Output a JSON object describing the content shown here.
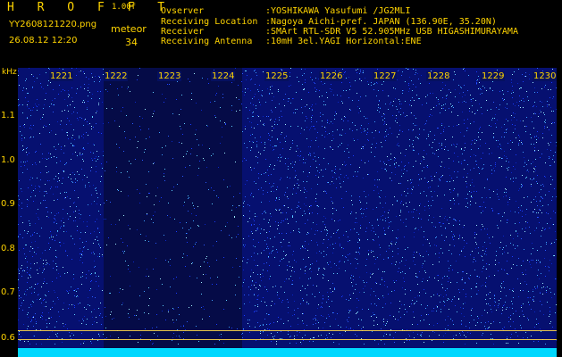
{
  "header": {
    "app_title": "H R O F F T",
    "version": "1.00f",
    "filename": "YY2608121220.png",
    "timestamp": "26.08.12 12:20",
    "detection_type": "meteor",
    "detection_count": "34",
    "info": [
      {
        "key": "Ovserver",
        "value": ":YOSHIKAWA Yasufumi /JG2MLI"
      },
      {
        "key": "Receiving Location",
        "value": ":Nagoya Aichi-pref. JAPAN (136.90E, 35.20N)"
      },
      {
        "key": "Receiver",
        "value": ":SMArt RTL-SDR V5 52.905MHz USB HIGASHIMURAYAMA"
      },
      {
        "key": "Receiving Antenna",
        "value": ":10mH 3el.YAGI Horizontal:ENE"
      }
    ]
  },
  "axes": {
    "y_unit": "kHz",
    "x_ticks": [
      "1221",
      "1222",
      "1223",
      "1224",
      "1225",
      "1226",
      "1227",
      "1228",
      "1229",
      "1230"
    ],
    "y_ticks": [
      "1.1",
      "1.0",
      "0.9",
      "0.8",
      "0.7",
      "0.6"
    ]
  },
  "colors": {
    "background": "#000000",
    "text": "#ffd400",
    "noise_base": "#061070",
    "noise_dark": "#050a3a",
    "cyan_bottom": "#00d8ff"
  }
}
